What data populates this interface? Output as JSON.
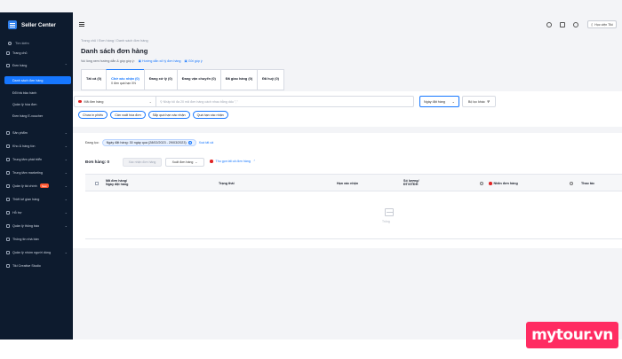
{
  "brand": {
    "name": "Seller Center"
  },
  "sidebar": {
    "search_label": "Tìm kiếm",
    "items": [
      {
        "label": "Trang chủ"
      },
      {
        "label": "Đơn hàng"
      },
      {
        "label": "Danh sách đơn hàng"
      },
      {
        "label": "Đổi trả bảo hành"
      },
      {
        "label": "Quản lý hóa đơn"
      },
      {
        "label": "Đơn hàng E-voucher"
      },
      {
        "label": "Sản phẩm"
      },
      {
        "label": "Kho & hàng tồn"
      },
      {
        "label": "Trung tâm phát triển"
      },
      {
        "label": "Trung tâm marketing"
      },
      {
        "label": "Quản lý tài chính",
        "badge": "New"
      },
      {
        "label": "Thiết kế gian hàng"
      },
      {
        "label": "Hỗ trợ"
      },
      {
        "label": "Quản lý thông báo"
      },
      {
        "label": "Thông tin nhà bán"
      },
      {
        "label": "Quản lý nhóm người dùng"
      },
      {
        "label": "Tiki Creative Studio"
      }
    ]
  },
  "topbar": {
    "academy_label": "Học viện Tiki"
  },
  "breadcrumb": "Trang chủ / Đơn hàng / Danh sách đơn hàng",
  "page_title": "Danh sách đơn hàng",
  "help": {
    "prefix": "Vui lòng xem hướng dẫn & góp góp ý:",
    "link1": "Hướng dẫn xử lý đơn hàng",
    "link2": "Gửi góp ý"
  },
  "tabs": [
    {
      "label": "Tất cả (0)",
      "count": ""
    },
    {
      "label": "Chờ xác nhận (0)",
      "count": "0 đơn quá hạn XN"
    },
    {
      "label": "Đang xử lý (0)",
      "count": ""
    },
    {
      "label": "Đang vận chuyển (0)",
      "count": ""
    },
    {
      "label": "Đã giao hàng (0)",
      "count": ""
    },
    {
      "label": "Đã huỷ (0)",
      "count": ""
    }
  ],
  "filter": {
    "field_label": "Mã đơn hàng",
    "input_placeholder": "Nhập tối đa 20 mã đơn hàng cách nhau bằng dấu \",\"",
    "date_label": "Ngày đặt hàng",
    "advanced_label": "Bộ lọc khác"
  },
  "chips": [
    "Chưa in phiếu",
    "Cần xuất hóa đơn",
    "Sắp quá hạn xác nhận",
    "Quá hạn xác nhận"
  ],
  "active_filter": {
    "label": "Đang lọc:",
    "tag": "Ngày đặt hàng: 30 ngày qua (28/02/2023 - 29/03/2023)",
    "clear_label": "Xoá tất cả"
  },
  "orders": {
    "count_label": "Đơn hàng: 0",
    "print_label": "Xác nhận đơn hàng",
    "export_label": "Xuất đơn hàng",
    "collapse_label": "Thu gọn tất cả đơn hàng"
  },
  "table": {
    "headers": [
      "Mã đơn hàng/\nNgày đặt hàng",
      "Trạng thái",
      "Hạn xác nhận",
      "Số lượng/\nĐT/GTĐH",
      "Nhãn đơn hàng",
      "Thao tác"
    ],
    "empty_text": "Trống"
  },
  "watermark": "mytour.vn"
}
